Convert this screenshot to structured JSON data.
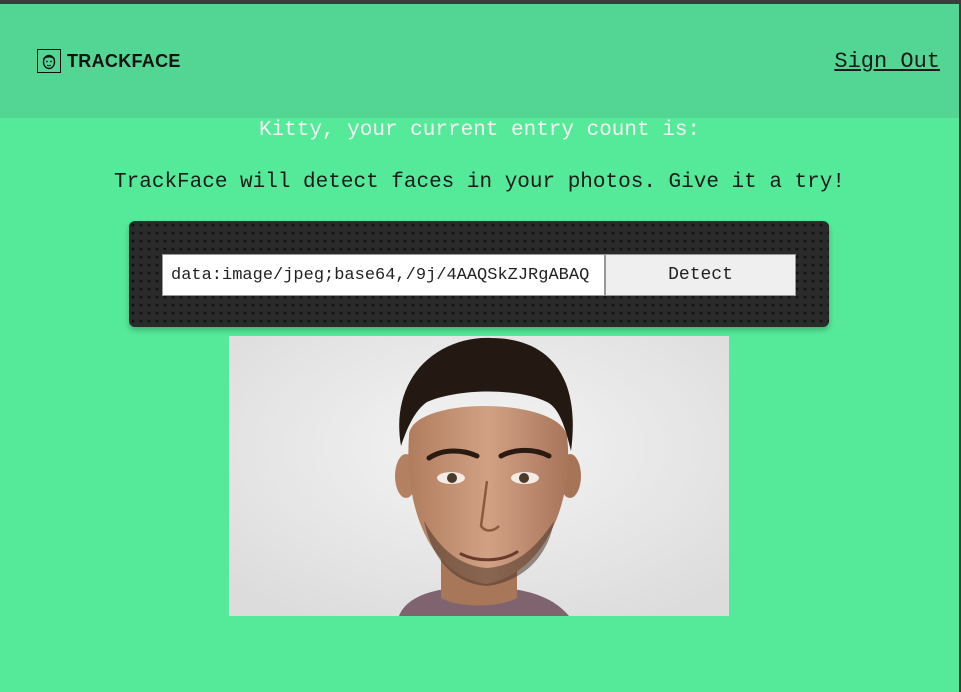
{
  "header": {
    "brand": "TRACKFACE",
    "brand_icon": "face-icon",
    "sign_out_label": "Sign Out"
  },
  "main": {
    "greeting": "Kitty, your current entry count is:",
    "tagline": "TrackFace will detect faces in your photos. Give it a try!",
    "image_url_value": "data:image/jpeg;base64,/9j/4AAQSkZJRgABAQ",
    "detect_label": "Detect"
  },
  "colors": {
    "page_background": "#55ea99",
    "header_background": "#53d693",
    "panel_background": "#2a2a2a"
  }
}
